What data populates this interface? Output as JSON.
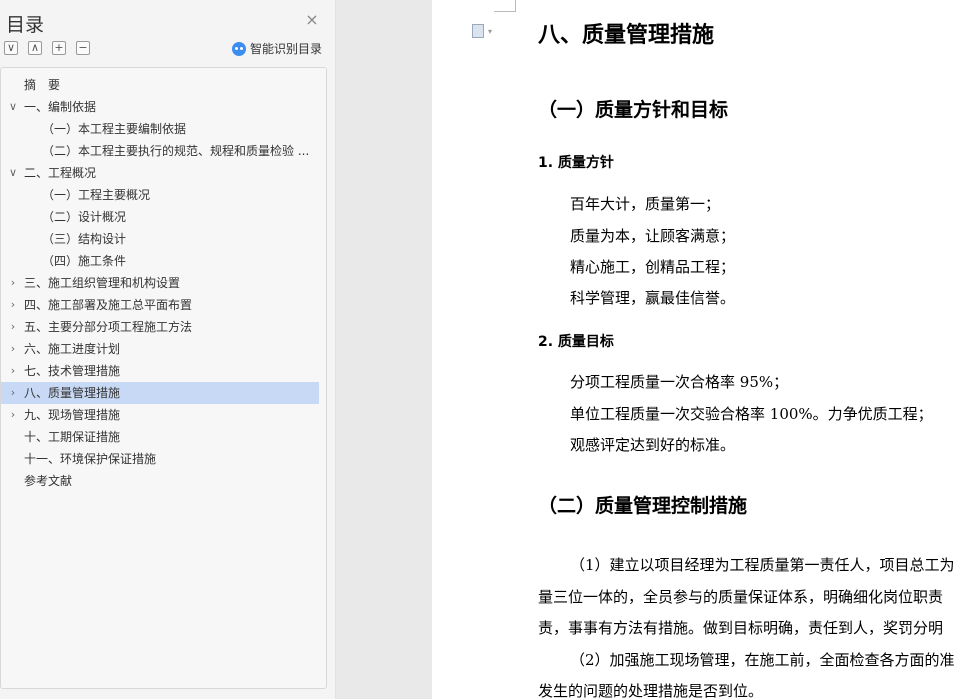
{
  "toc": {
    "title": "目录",
    "close_glyph": "×",
    "tools": {
      "collapse_glyph": "∨",
      "expand_glyph": "∧",
      "add_glyph": "+",
      "remove_glyph": "−"
    },
    "smart_label": "智能识别目录",
    "items": [
      {
        "label": "摘　要",
        "arrow": ""
      },
      {
        "label": "一、编制依据",
        "arrow": "∨"
      },
      {
        "label": "（一）本工程主要编制依据",
        "arrow": ""
      },
      {
        "label": "（二）本工程主要执行的规范、规程和质量检验 ...",
        "arrow": ""
      },
      {
        "label": "二、工程概况",
        "arrow": "∨"
      },
      {
        "label": "（一）工程主要概况",
        "arrow": ""
      },
      {
        "label": "（二）设计概况",
        "arrow": ""
      },
      {
        "label": "（三）结构设计",
        "arrow": ""
      },
      {
        "label": "（四）施工条件",
        "arrow": ""
      },
      {
        "label": "三、施工组织管理和机构设置",
        "arrow": "›"
      },
      {
        "label": "四、施工部署及施工总平面布置",
        "arrow": "›"
      },
      {
        "label": "五、主要分部分项工程施工方法",
        "arrow": "›"
      },
      {
        "label": "六、施工进度计划",
        "arrow": "›"
      },
      {
        "label": "七、技术管理措施",
        "arrow": "›"
      },
      {
        "label": "八、质量管理措施",
        "arrow": "›"
      },
      {
        "label": "九、现场管理措施",
        "arrow": "›"
      },
      {
        "label": "十、工期保证措施",
        "arrow": ""
      },
      {
        "label": "十一、环境保护保证措施",
        "arrow": ""
      },
      {
        "label": "参考文献",
        "arrow": ""
      }
    ]
  },
  "doc": {
    "caret_glyph": "▾",
    "h1": "八、质量管理措施",
    "sec1_title": "（一）质量方针和目标",
    "sub1_title": "1.  质量方针",
    "policy_lines": [
      "百年大计，质量第一；",
      "质量为本，让顾客满意；",
      "精心施工，创精品工程；",
      "科学管理，赢最佳信誉。"
    ],
    "sub2_title": "2.  质量目标",
    "goal_lines": [
      "分项工程质量一次合格率 95%；",
      "单位工程质量一次交验合格率 100%。力争优质工程；",
      "观感评定达到好的标准。"
    ],
    "sec2_title": "（二）质量管理控制措施",
    "body_lines": [
      "（1）建立以项目经理为工程质量第一责任人，项目总工为",
      "量三位一体的，全员参与的质量保证体系，明确细化岗位职责",
      "责，事事有方法有措施。做到目标明确，责任到人，奖罚分明",
      "（2）加强施工现场管理，在施工前，全面检查各方面的准",
      "发生的问题的处理措施是否到位。"
    ]
  },
  "colors": {
    "active_item_bg": "#c8d9f5",
    "smart_icon": "#3b8ef0",
    "panel_bg": "#f4f4f4",
    "page_bg": "#ffffff"
  }
}
